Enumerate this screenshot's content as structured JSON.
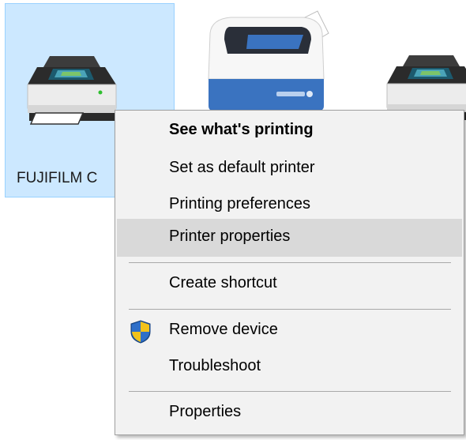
{
  "devices": [
    {
      "label": "FUJIFILM C",
      "icon": "printer-icon",
      "selected": true
    },
    {
      "label": "",
      "icon": "xerox-printer-icon",
      "selected": false
    },
    {
      "label": "",
      "icon": "printer-icon",
      "selected": false
    }
  ],
  "context_menu": {
    "items": {
      "see_printing": "See what's printing",
      "set_default": "Set as default printer",
      "printing_prefs": "Printing preferences",
      "printer_props": "Printer properties",
      "create_shortcut": "Create shortcut",
      "remove_device": "Remove device",
      "troubleshoot": "Troubleshoot",
      "properties": "Properties"
    },
    "highlighted_item": "Printer properties",
    "shield_icon": "uac-shield-icon"
  },
  "colors": {
    "selection_bg": "#cce8ff",
    "selection_border": "#99d1ff",
    "menu_bg": "#f2f2f2",
    "menu_highlight": "#d9d9d9",
    "xerox_blue": "#3a73c0"
  }
}
